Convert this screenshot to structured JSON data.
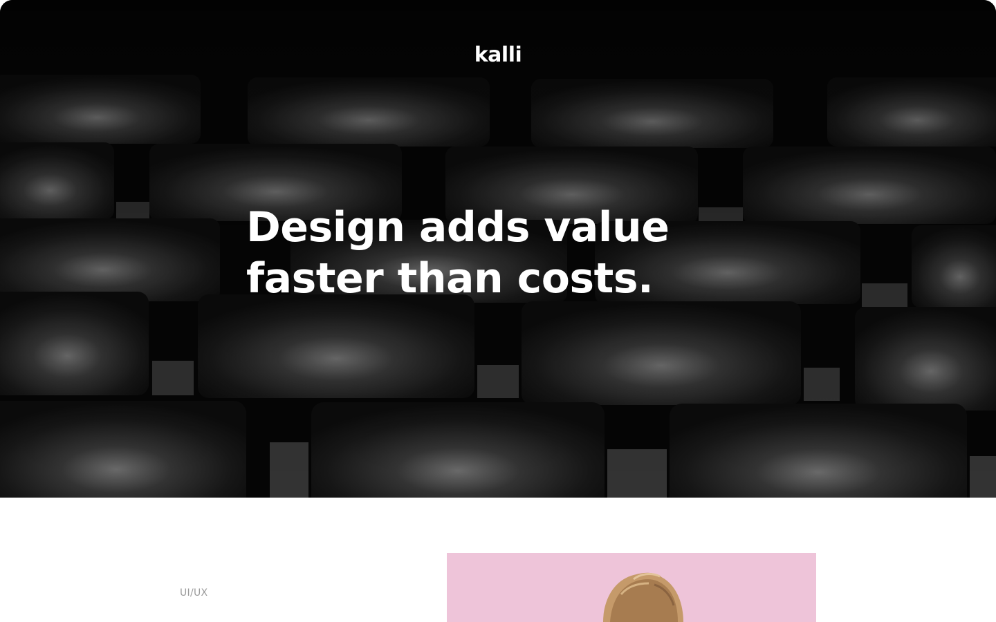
{
  "header": {
    "logo_text": "kalli"
  },
  "hero": {
    "headline_line1": "Design adds value",
    "headline_line2": "faster than costs.",
    "photo": "theater-seats-photo"
  },
  "project": {
    "category": "UI/UX",
    "image": "portrait-photo",
    "image_bg_color": "#eec4d9"
  }
}
